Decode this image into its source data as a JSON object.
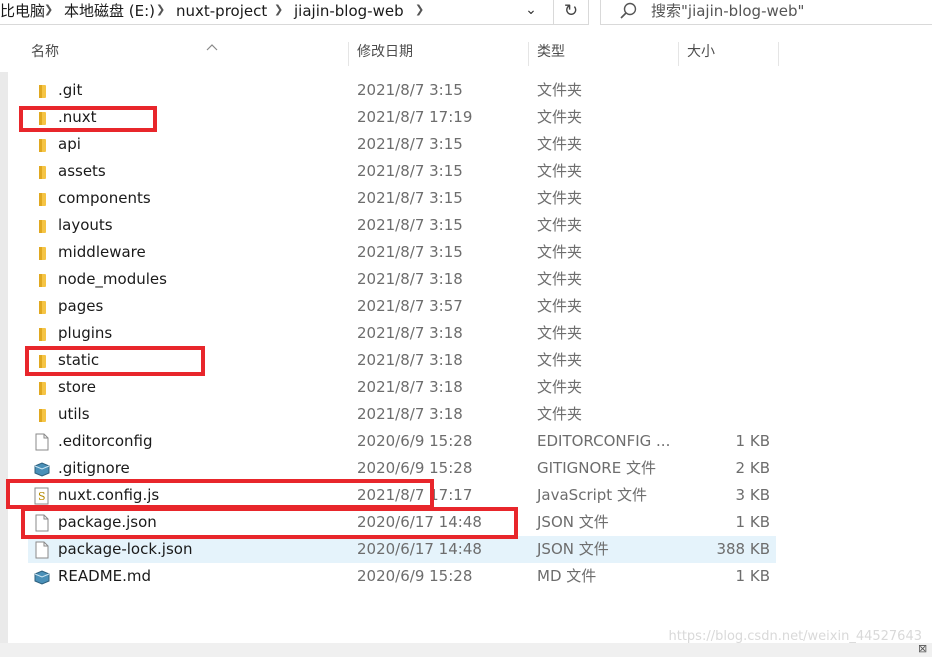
{
  "address_bar": {
    "crumbs": [
      "比电脑",
      "本地磁盘 (E:)",
      "nuxt-project",
      "jiajin-blog-web"
    ],
    "separator_icon": "chevron-right-icon",
    "dropdown_icon": "chevron-down-icon",
    "refresh_icon": "refresh-icon"
  },
  "search": {
    "placeholder": "搜索\"jiajin-blog-web\"",
    "icon": "search-icon"
  },
  "columns": {
    "name": "名称",
    "date": "修改日期",
    "type": "类型",
    "size": "大小"
  },
  "files": [
    {
      "name": ".git",
      "date": "2021/8/7 3:15",
      "type": "文件夹",
      "size": "",
      "icon": "folder-icon"
    },
    {
      "name": ".nuxt",
      "date": "2021/8/7 17:19",
      "type": "文件夹",
      "size": "",
      "icon": "folder-icon"
    },
    {
      "name": "api",
      "date": "2021/8/7 3:15",
      "type": "文件夹",
      "size": "",
      "icon": "folder-icon"
    },
    {
      "name": "assets",
      "date": "2021/8/7 3:15",
      "type": "文件夹",
      "size": "",
      "icon": "folder-icon"
    },
    {
      "name": "components",
      "date": "2021/8/7 3:15",
      "type": "文件夹",
      "size": "",
      "icon": "folder-icon"
    },
    {
      "name": "layouts",
      "date": "2021/8/7 3:15",
      "type": "文件夹",
      "size": "",
      "icon": "folder-icon"
    },
    {
      "name": "middleware",
      "date": "2021/8/7 3:15",
      "type": "文件夹",
      "size": "",
      "icon": "folder-icon"
    },
    {
      "name": "node_modules",
      "date": "2021/8/7 3:18",
      "type": "文件夹",
      "size": "",
      "icon": "folder-icon"
    },
    {
      "name": "pages",
      "date": "2021/8/7 3:57",
      "type": "文件夹",
      "size": "",
      "icon": "folder-icon"
    },
    {
      "name": "plugins",
      "date": "2021/8/7 3:18",
      "type": "文件夹",
      "size": "",
      "icon": "folder-icon"
    },
    {
      "name": "static",
      "date": "2021/8/7 3:18",
      "type": "文件夹",
      "size": "",
      "icon": "folder-icon"
    },
    {
      "name": "store",
      "date": "2021/8/7 3:18",
      "type": "文件夹",
      "size": "",
      "icon": "folder-icon"
    },
    {
      "name": "utils",
      "date": "2021/8/7 3:18",
      "type": "文件夹",
      "size": "",
      "icon": "folder-icon"
    },
    {
      "name": ".editorconfig",
      "date": "2020/6/9 15:28",
      "type": "EDITORCONFIG ...",
      "size": "1 KB",
      "icon": "file-icon"
    },
    {
      "name": ".gitignore",
      "date": "2020/6/9 15:28",
      "type": "GITIGNORE 文件",
      "size": "2 KB",
      "icon": "generic-app-file-icon"
    },
    {
      "name": "nuxt.config.js",
      "date": "2021/8/7 17:17",
      "type": "JavaScript 文件",
      "size": "3 KB",
      "icon": "js-file-icon"
    },
    {
      "name": "package.json",
      "date": "2020/6/17 14:48",
      "type": "JSON 文件",
      "size": "1 KB",
      "icon": "file-icon"
    },
    {
      "name": "package-lock.json",
      "date": "2020/6/17 14:48",
      "type": "JSON 文件",
      "size": "388 KB",
      "icon": "file-icon",
      "selected": true
    },
    {
      "name": "README.md",
      "date": "2020/6/9 15:28",
      "type": "MD 文件",
      "size": "1 KB",
      "icon": "generic-app-file-icon"
    }
  ],
  "highlighted_items": [
    ".nuxt",
    "static",
    "nuxt.config.js",
    "package.json"
  ],
  "watermark": "https://blog.csdn.net/weixin_44527643",
  "colors": {
    "highlight": "#e8262b",
    "folder": "#f5c445",
    "selected_row": "#e5f3fb"
  }
}
